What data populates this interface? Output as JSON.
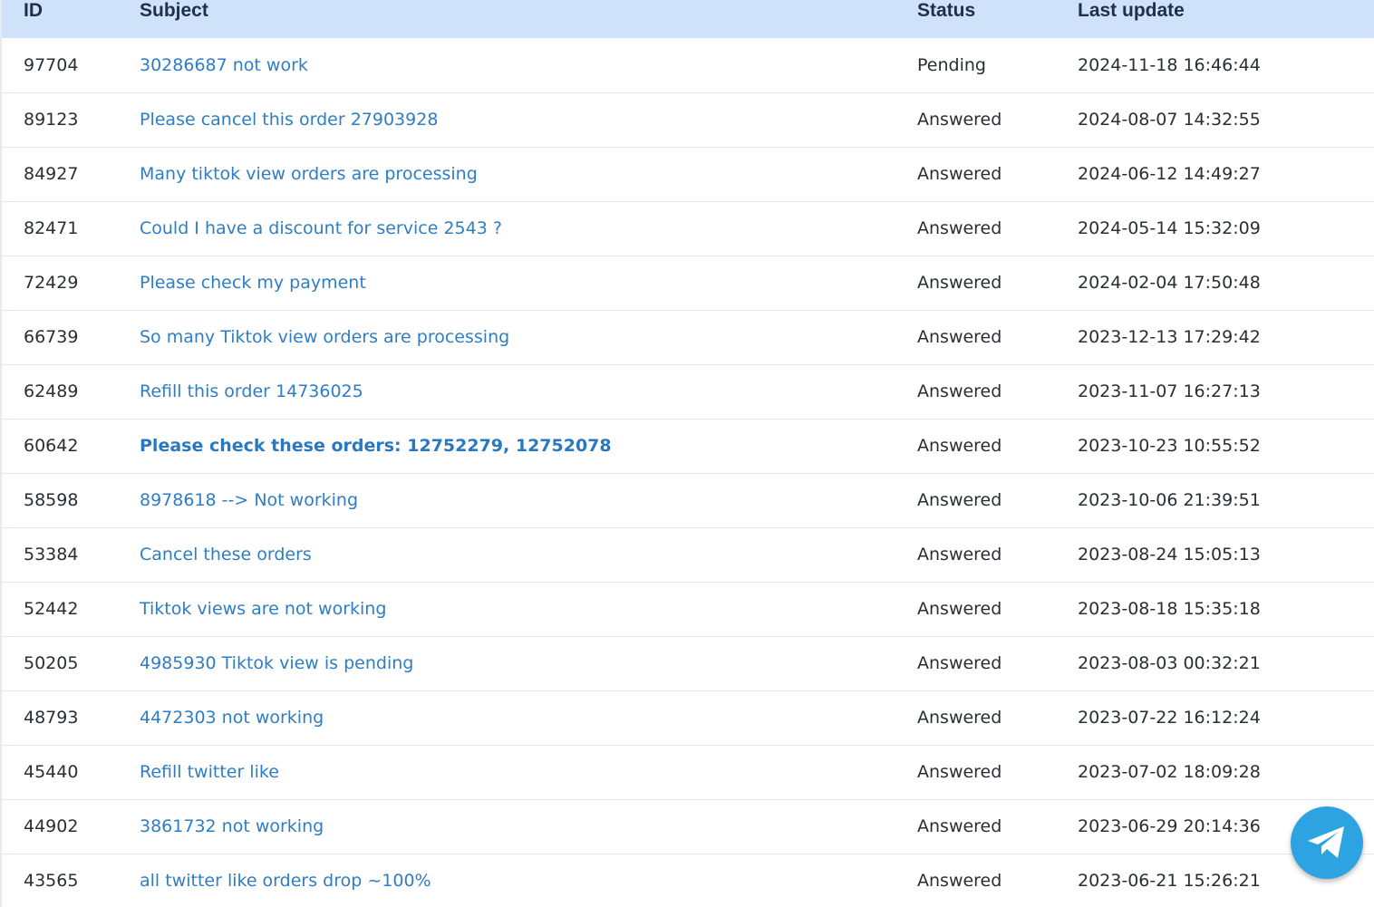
{
  "table": {
    "headers": {
      "id": "ID",
      "subject": "Subject",
      "status": "Status",
      "last_update": "Last update"
    },
    "rows": [
      {
        "id": "97704",
        "subject": "30286687 not work",
        "status": "Pending",
        "last_update": "2024-11-18 16:46:44",
        "unread": false
      },
      {
        "id": "89123",
        "subject": "Please cancel this order 27903928",
        "status": "Answered",
        "last_update": "2024-08-07 14:32:55",
        "unread": false
      },
      {
        "id": "84927",
        "subject": "Many tiktok view orders are processing",
        "status": "Answered",
        "last_update": "2024-06-12 14:49:27",
        "unread": false
      },
      {
        "id": "82471",
        "subject": "Could I have a discount for service 2543 ?",
        "status": "Answered",
        "last_update": "2024-05-14 15:32:09",
        "unread": false
      },
      {
        "id": "72429",
        "subject": "Please check my payment",
        "status": "Answered",
        "last_update": "2024-02-04 17:50:48",
        "unread": false
      },
      {
        "id": "66739",
        "subject": "So many Tiktok view orders are processing",
        "status": "Answered",
        "last_update": "2023-12-13 17:29:42",
        "unread": false
      },
      {
        "id": "62489",
        "subject": "Refill this order 14736025",
        "status": "Answered",
        "last_update": "2023-11-07 16:27:13",
        "unread": false
      },
      {
        "id": "60642",
        "subject": "Please check these orders: 12752279, 12752078",
        "status": "Answered",
        "last_update": "2023-10-23 10:55:52",
        "unread": true
      },
      {
        "id": "58598",
        "subject": "8978618 --> Not working",
        "status": "Answered",
        "last_update": "2023-10-06 21:39:51",
        "unread": false
      },
      {
        "id": "53384",
        "subject": "Cancel these orders",
        "status": "Answered",
        "last_update": "2023-08-24 15:05:13",
        "unread": false
      },
      {
        "id": "52442",
        "subject": "Tiktok views are not working",
        "status": "Answered",
        "last_update": "2023-08-18 15:35:18",
        "unread": false
      },
      {
        "id": "50205",
        "subject": "4985930 Tiktok view is pending",
        "status": "Answered",
        "last_update": "2023-08-03 00:32:21",
        "unread": false
      },
      {
        "id": "48793",
        "subject": "4472303 not working",
        "status": "Answered",
        "last_update": "2023-07-22 16:12:24",
        "unread": false
      },
      {
        "id": "45440",
        "subject": "Refill twitter like",
        "status": "Answered",
        "last_update": "2023-07-02 18:09:28",
        "unread": false
      },
      {
        "id": "44902",
        "subject": "3861732 not working",
        "status": "Answered",
        "last_update": "2023-06-29 20:14:36",
        "unread": false
      },
      {
        "id": "43565",
        "subject": "all twitter like orders drop ~100%",
        "status": "Answered",
        "last_update": "2023-06-21 15:26:21",
        "unread": false
      }
    ]
  },
  "floating_button": {
    "icon": "telegram-icon",
    "color": "#2ea3e2"
  },
  "colors": {
    "header_bg": "#cfe2fa",
    "link": "#2f7dc4",
    "text": "#2a2e33"
  }
}
